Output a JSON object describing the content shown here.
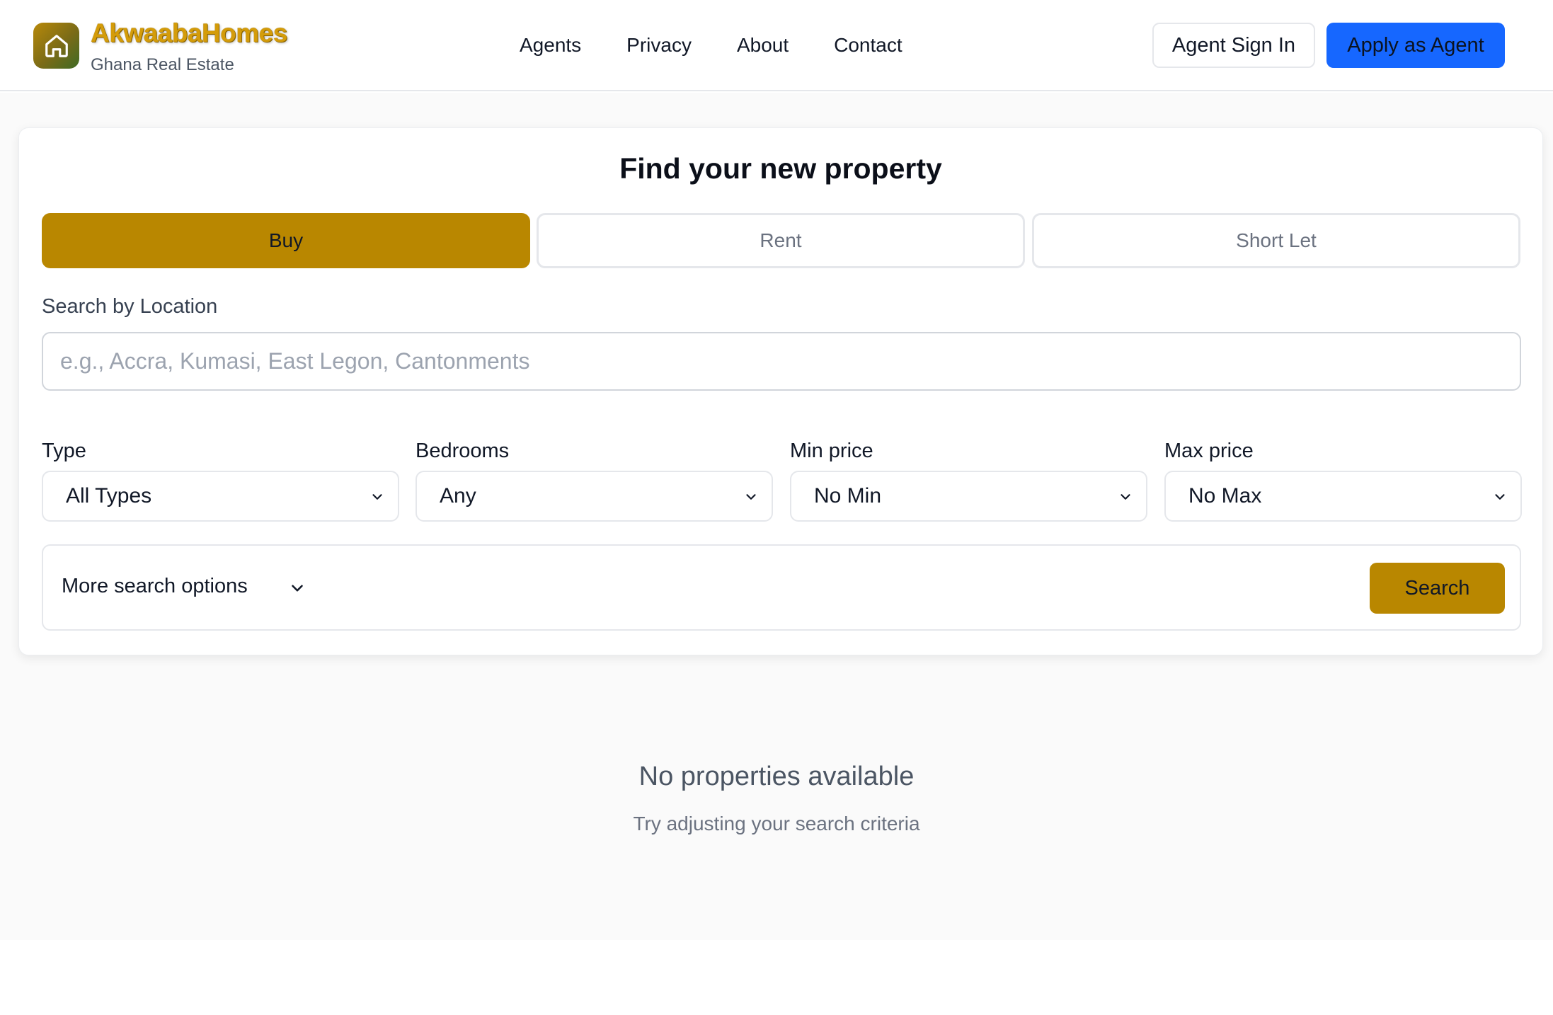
{
  "brand": {
    "name": "AkwaabaHomes",
    "tagline": "Ghana Real Estate",
    "logo_icon": "home-icon"
  },
  "nav": {
    "links": [
      "Agents",
      "Privacy",
      "About",
      "Contact"
    ]
  },
  "header_actions": {
    "sign_in": "Agent Sign In",
    "apply": "Apply as Agent"
  },
  "search": {
    "title": "Find your new property",
    "tabs": [
      {
        "label": "Buy",
        "active": true
      },
      {
        "label": "Rent",
        "active": false
      },
      {
        "label": "Short Let",
        "active": false
      }
    ],
    "location_label": "Search by Location",
    "location_placeholder": "e.g., Accra, Kumasi, East Legon, Cantonments",
    "location_value": "",
    "filters": [
      {
        "label": "Type",
        "selected": "All Types"
      },
      {
        "label": "Bedrooms",
        "selected": "Any"
      },
      {
        "label": "Min price",
        "selected": "No Min"
      },
      {
        "label": "Max price",
        "selected": "No Max"
      }
    ],
    "more_options": "More search options",
    "search_button": "Search"
  },
  "results": {
    "empty_title": "No properties available",
    "empty_subtitle": "Try adjusting your search criteria"
  },
  "colors": {
    "accent_gold": "#b98700",
    "primary_blue": "#1667ff",
    "brand_text": "#d49c0a"
  }
}
